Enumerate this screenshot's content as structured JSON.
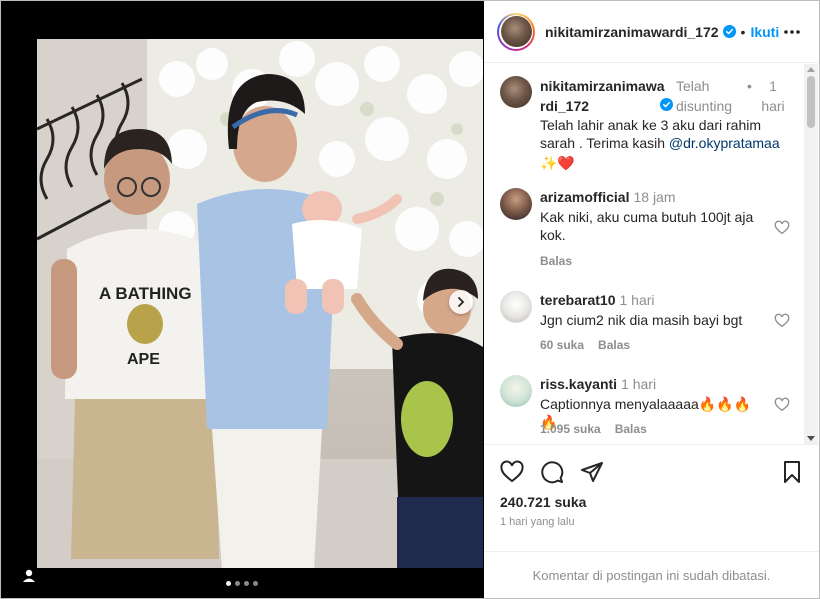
{
  "post": {
    "username": "nikitamirzanimawardi_172",
    "follow_label": "Ikuti",
    "separator": "•",
    "caption": {
      "username": "nikitamirzanimawardi_172",
      "edited_label": "Telah disunting",
      "separator": "•",
      "time": "1 hari",
      "text_before": "Telah lahir anak ke 3 aku dari rahim sarah . Terima kasih ",
      "mention": "@dr.okypratamaa",
      "emojis": "✨❤️"
    },
    "comments": [
      {
        "username": "arizamofficial",
        "time": "18 jam",
        "text": "Kak niki, aku cuma butuh 100jt aja kok.",
        "likes": "",
        "reply_label": "Balas"
      },
      {
        "username": "terebarat10",
        "time": "1 hari",
        "text": "Jgn cium2 nik dia masih bayi bgt",
        "likes": "60 suka",
        "reply_label": "Balas"
      },
      {
        "username": "riss.kayanti",
        "time": "1 hari",
        "text": "Captionnya menyalaaaaa🔥🔥🔥🔥",
        "likes": "1.095 suka",
        "reply_label": "Balas"
      }
    ],
    "like_count": "240.721 suka",
    "time_ago": "1 hari yang lalu",
    "comments_limited": "Komentar di postingan ini sudah dibatasi.",
    "carousel": {
      "total": 4,
      "active": 1
    }
  },
  "icons": {
    "verified": "verified-badge-icon",
    "more": "more-options-icon",
    "heart": "heart-icon",
    "comment": "comment-icon",
    "share": "share-icon",
    "save": "bookmark-icon",
    "next": "chevron-right-icon",
    "tag": "user-tag-icon"
  },
  "colors": {
    "accent": "#0095f6",
    "muted": "#8e8e8e",
    "mention": "#00376b"
  }
}
